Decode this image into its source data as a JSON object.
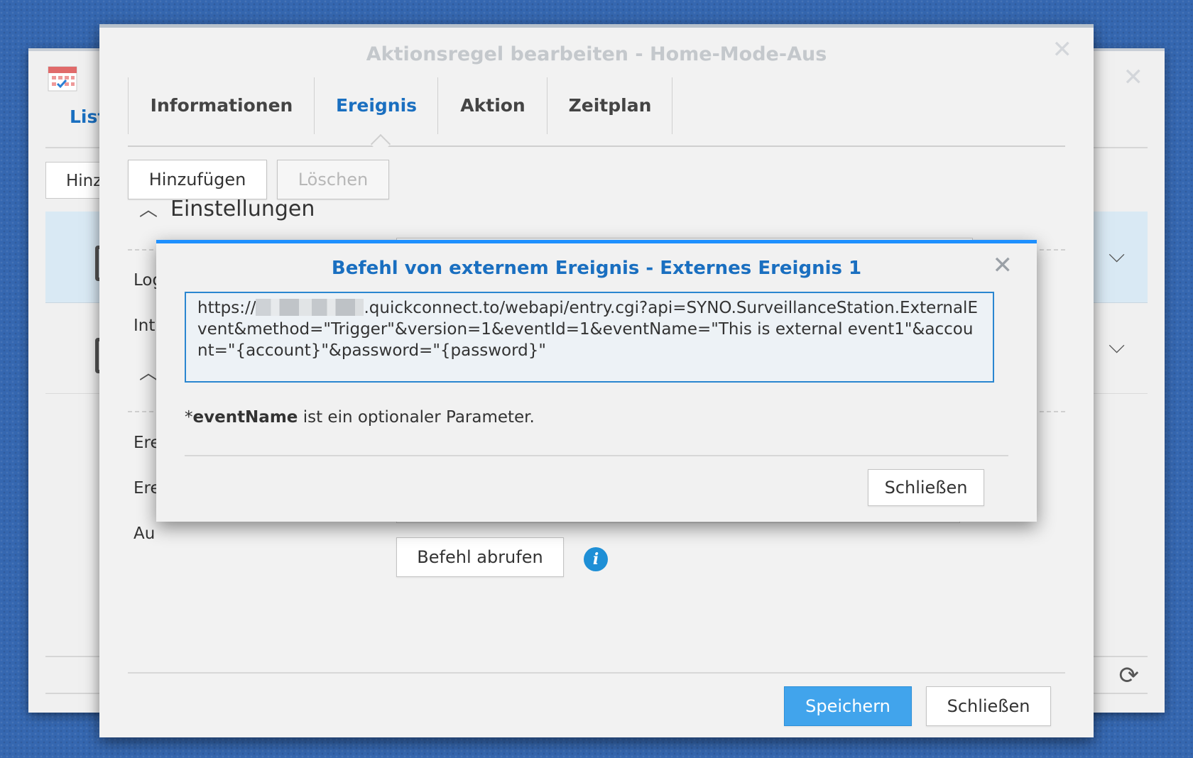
{
  "back_window": {
    "tab_label": "List",
    "add_button_label": "Hinz",
    "colors": {
      "tab_active": "#1a6fc0",
      "selected_row": "#d9e9f4"
    }
  },
  "main_window": {
    "title": "Aktionsregel bearbeiten - Home-Mode-Aus",
    "tabs": [
      {
        "label": "Informationen",
        "active": false
      },
      {
        "label": "Ereignis",
        "active": true
      },
      {
        "label": "Aktion",
        "active": false
      },
      {
        "label": "Zeitplan",
        "active": false
      }
    ],
    "toolbar": {
      "add_label": "Hinzufügen",
      "delete_label": "Löschen"
    },
    "section_title": "Einstellungen",
    "field_labels": [
      "Log",
      "Int",
      "Ere",
      "Ere",
      "Au"
    ],
    "get_command_label": "Befehl abrufen",
    "info_icon_glyph": "i",
    "footer": {
      "save_label": "Speichern",
      "close_label": "Schließen"
    },
    "colors": {
      "primary_button": "#41a4ec",
      "accent": "#1a6fc0"
    }
  },
  "modal": {
    "title": "Befehl von externem Ereignis - Externes Ereignis 1",
    "command_prefix": "https://",
    "command_rest": ".quickconnect.to/webapi/entry.cgi?api=SYNO.SurveillanceStation.ExternalEvent&method=\"Trigger\"&version=1&eventId=1&eventName=\"This is external event1\"&account=\"{account}\"&password=\"{password}\"",
    "note_param": "eventName",
    "note_prefix": "*",
    "note_text": " ist ein optionaler Parameter.",
    "close_label": "Schließen",
    "colors": {
      "title": "#1a6fc0",
      "top_border": "#1e90ff",
      "box_border": "#2a86d0"
    }
  }
}
